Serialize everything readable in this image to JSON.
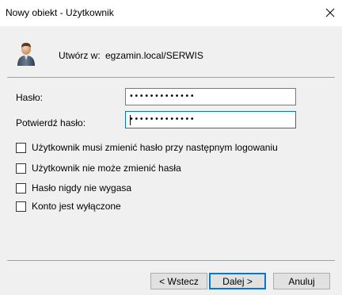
{
  "window": {
    "title": "Nowy obiekt - Użytkownik",
    "close_icon": "close-icon"
  },
  "header": {
    "icon": "user-icon",
    "create_in_label": "Utwórz w:",
    "create_in_value": "egzamin.local/SERWIS"
  },
  "form": {
    "password_label": "Hasło:",
    "password_value": "•••••••••••••",
    "confirm_label": "Potwierdź hasło:",
    "confirm_value": "•••••••••••••"
  },
  "options": [
    {
      "label": "Użytkownik musi zmienić hasło przy następnym logowaniu",
      "checked": false
    },
    {
      "label": "Użytkownik nie może zmienić hasła",
      "checked": false
    },
    {
      "label": "Hasło nigdy nie wygasa",
      "checked": false
    },
    {
      "label": "Konto jest wyłączone",
      "checked": false
    }
  ],
  "buttons": {
    "back": "< Wstecz",
    "next": "Dalej >",
    "cancel": "Anuluj"
  }
}
